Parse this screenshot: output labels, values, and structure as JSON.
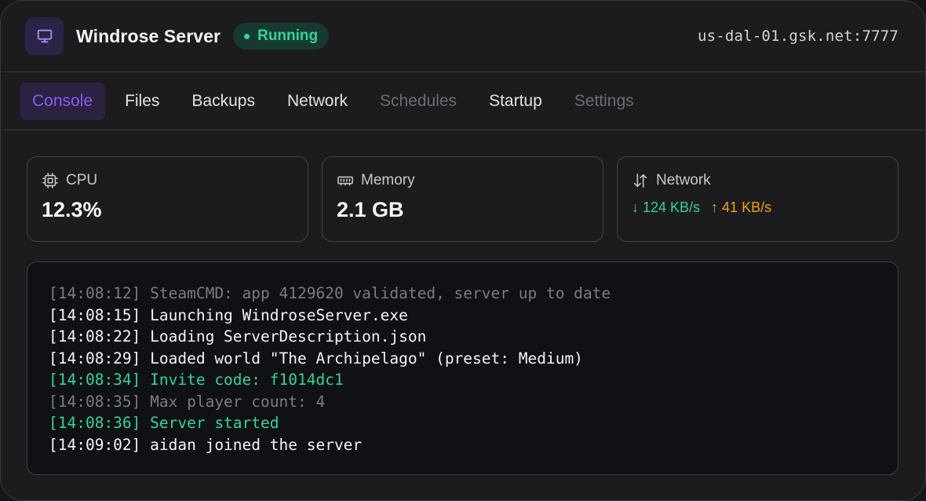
{
  "header": {
    "title": "Windrose Server",
    "status": "Running",
    "address": "us-dal-01.gsk.net:7777",
    "icon": "monitor-icon"
  },
  "tabs": [
    {
      "label": "Console",
      "state": "active"
    },
    {
      "label": "Files",
      "state": "normal"
    },
    {
      "label": "Backups",
      "state": "normal"
    },
    {
      "label": "Network",
      "state": "normal"
    },
    {
      "label": "Schedules",
      "state": "disabled"
    },
    {
      "label": "Startup",
      "state": "normal"
    },
    {
      "label": "Settings",
      "state": "disabled"
    }
  ],
  "stats": {
    "cpu": {
      "label": "CPU",
      "value": "12.3%",
      "icon": "cpu-icon"
    },
    "memory": {
      "label": "Memory",
      "value": "2.1 GB",
      "icon": "memory-icon"
    },
    "network": {
      "label": "Network",
      "down": "↓ 124 KB/s",
      "up": "↑ 41 KB/s",
      "icon": "transfer-icon"
    }
  },
  "console": {
    "lines": [
      {
        "text": "[14:08:12] SteamCMD: app 4129620 validated, server up to date",
        "style": "dim"
      },
      {
        "text": "[14:08:15] Launching WindroseServer.exe",
        "style": "normal"
      },
      {
        "text": "[14:08:22] Loading ServerDescription.json",
        "style": "normal"
      },
      {
        "text": "[14:08:29] Loaded world \"The Archipelago\" (preset: Medium)",
        "style": "normal"
      },
      {
        "text": "[14:08:34] Invite code: f1014dc1",
        "style": "success"
      },
      {
        "text": "[14:08:35] Max player count: 4",
        "style": "dim"
      },
      {
        "text": "[14:08:36] Server started",
        "style": "success"
      },
      {
        "text": "[14:09:02] aidan joined the server",
        "style": "normal"
      }
    ]
  },
  "colors": {
    "accent": "#8b5cf6",
    "success": "#34d399",
    "warning": "#f59e0b",
    "background": "#1c1c1f",
    "console_bg": "#0f1115"
  }
}
